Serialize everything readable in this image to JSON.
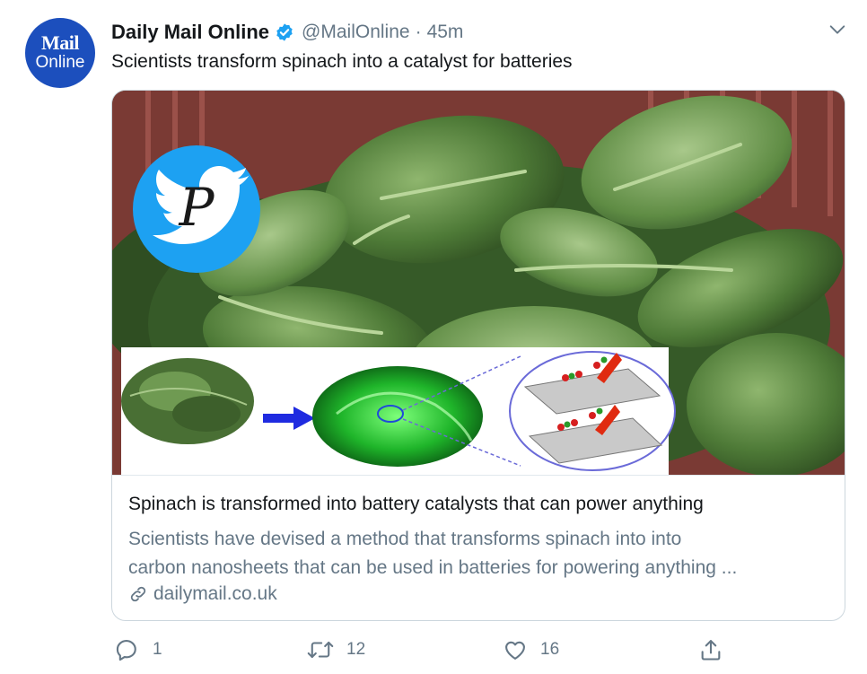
{
  "author": {
    "avatar_line1": "Mail",
    "avatar_line2": "Online",
    "display_name": "Daily Mail Online",
    "verified": true,
    "handle": "@MailOnline",
    "separator": "·",
    "time": "45m"
  },
  "tweet": {
    "text": "Scientists transform spinach into a catalyst for batteries"
  },
  "card": {
    "title": "Spinach is transformed into battery catalysts that can power anything",
    "description_line1": "Scientists have devised a method that transforms spinach into into",
    "description_line2": "carbon nanosheets that can be used in batteries for powering anything ...",
    "domain": "dailymail.co.uk",
    "image_overlay_letter": "P"
  },
  "actions": {
    "reply_count": "1",
    "retweet_count": "12",
    "like_count": "16"
  },
  "colors": {
    "accent": "#1da1f2",
    "avatar_bg": "#1c4fbd",
    "secondary_text": "#657786",
    "arrow_blue": "#1f2be0"
  },
  "icons": [
    "verified-badge-icon",
    "chevron-down-icon",
    "link-icon",
    "reply-icon",
    "retweet-icon",
    "like-icon",
    "share-icon",
    "twitter-bird-logo"
  ]
}
